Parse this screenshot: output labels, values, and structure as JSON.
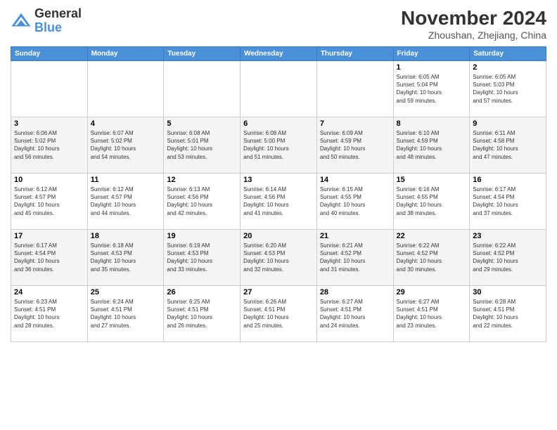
{
  "header": {
    "logo_line1": "General",
    "logo_line2": "Blue",
    "month_title": "November 2024",
    "location": "Zhoushan, Zhejiang, China"
  },
  "weekdays": [
    "Sunday",
    "Monday",
    "Tuesday",
    "Wednesday",
    "Thursday",
    "Friday",
    "Saturday"
  ],
  "weeks": [
    [
      {
        "day": "",
        "info": ""
      },
      {
        "day": "",
        "info": ""
      },
      {
        "day": "",
        "info": ""
      },
      {
        "day": "",
        "info": ""
      },
      {
        "day": "",
        "info": ""
      },
      {
        "day": "1",
        "info": "Sunrise: 6:05 AM\nSunset: 5:04 PM\nDaylight: 10 hours\nand 59 minutes."
      },
      {
        "day": "2",
        "info": "Sunrise: 6:05 AM\nSunset: 5:03 PM\nDaylight: 10 hours\nand 57 minutes."
      }
    ],
    [
      {
        "day": "3",
        "info": "Sunrise: 6:06 AM\nSunset: 5:02 PM\nDaylight: 10 hours\nand 56 minutes."
      },
      {
        "day": "4",
        "info": "Sunrise: 6:07 AM\nSunset: 5:02 PM\nDaylight: 10 hours\nand 54 minutes."
      },
      {
        "day": "5",
        "info": "Sunrise: 6:08 AM\nSunset: 5:01 PM\nDaylight: 10 hours\nand 53 minutes."
      },
      {
        "day": "6",
        "info": "Sunrise: 6:08 AM\nSunset: 5:00 PM\nDaylight: 10 hours\nand 51 minutes."
      },
      {
        "day": "7",
        "info": "Sunrise: 6:09 AM\nSunset: 4:59 PM\nDaylight: 10 hours\nand 50 minutes."
      },
      {
        "day": "8",
        "info": "Sunrise: 6:10 AM\nSunset: 4:59 PM\nDaylight: 10 hours\nand 48 minutes."
      },
      {
        "day": "9",
        "info": "Sunrise: 6:11 AM\nSunset: 4:58 PM\nDaylight: 10 hours\nand 47 minutes."
      }
    ],
    [
      {
        "day": "10",
        "info": "Sunrise: 6:12 AM\nSunset: 4:57 PM\nDaylight: 10 hours\nand 45 minutes."
      },
      {
        "day": "11",
        "info": "Sunrise: 6:12 AM\nSunset: 4:57 PM\nDaylight: 10 hours\nand 44 minutes."
      },
      {
        "day": "12",
        "info": "Sunrise: 6:13 AM\nSunset: 4:56 PM\nDaylight: 10 hours\nand 42 minutes."
      },
      {
        "day": "13",
        "info": "Sunrise: 6:14 AM\nSunset: 4:56 PM\nDaylight: 10 hours\nand 41 minutes."
      },
      {
        "day": "14",
        "info": "Sunrise: 6:15 AM\nSunset: 4:55 PM\nDaylight: 10 hours\nand 40 minutes."
      },
      {
        "day": "15",
        "info": "Sunrise: 6:16 AM\nSunset: 4:55 PM\nDaylight: 10 hours\nand 38 minutes."
      },
      {
        "day": "16",
        "info": "Sunrise: 6:17 AM\nSunset: 4:54 PM\nDaylight: 10 hours\nand 37 minutes."
      }
    ],
    [
      {
        "day": "17",
        "info": "Sunrise: 6:17 AM\nSunset: 4:54 PM\nDaylight: 10 hours\nand 36 minutes."
      },
      {
        "day": "18",
        "info": "Sunrise: 6:18 AM\nSunset: 4:53 PM\nDaylight: 10 hours\nand 35 minutes."
      },
      {
        "day": "19",
        "info": "Sunrise: 6:19 AM\nSunset: 4:53 PM\nDaylight: 10 hours\nand 33 minutes."
      },
      {
        "day": "20",
        "info": "Sunrise: 6:20 AM\nSunset: 4:53 PM\nDaylight: 10 hours\nand 32 minutes."
      },
      {
        "day": "21",
        "info": "Sunrise: 6:21 AM\nSunset: 4:52 PM\nDaylight: 10 hours\nand 31 minutes."
      },
      {
        "day": "22",
        "info": "Sunrise: 6:22 AM\nSunset: 4:52 PM\nDaylight: 10 hours\nand 30 minutes."
      },
      {
        "day": "23",
        "info": "Sunrise: 6:22 AM\nSunset: 4:52 PM\nDaylight: 10 hours\nand 29 minutes."
      }
    ],
    [
      {
        "day": "24",
        "info": "Sunrise: 6:23 AM\nSunset: 4:51 PM\nDaylight: 10 hours\nand 28 minutes."
      },
      {
        "day": "25",
        "info": "Sunrise: 6:24 AM\nSunset: 4:51 PM\nDaylight: 10 hours\nand 27 minutes."
      },
      {
        "day": "26",
        "info": "Sunrise: 6:25 AM\nSunset: 4:51 PM\nDaylight: 10 hours\nand 26 minutes."
      },
      {
        "day": "27",
        "info": "Sunrise: 6:26 AM\nSunset: 4:51 PM\nDaylight: 10 hours\nand 25 minutes."
      },
      {
        "day": "28",
        "info": "Sunrise: 6:27 AM\nSunset: 4:51 PM\nDaylight: 10 hours\nand 24 minutes."
      },
      {
        "day": "29",
        "info": "Sunrise: 6:27 AM\nSunset: 4:51 PM\nDaylight: 10 hours\nand 23 minutes."
      },
      {
        "day": "30",
        "info": "Sunrise: 6:28 AM\nSunset: 4:51 PM\nDaylight: 10 hours\nand 22 minutes."
      }
    ]
  ]
}
